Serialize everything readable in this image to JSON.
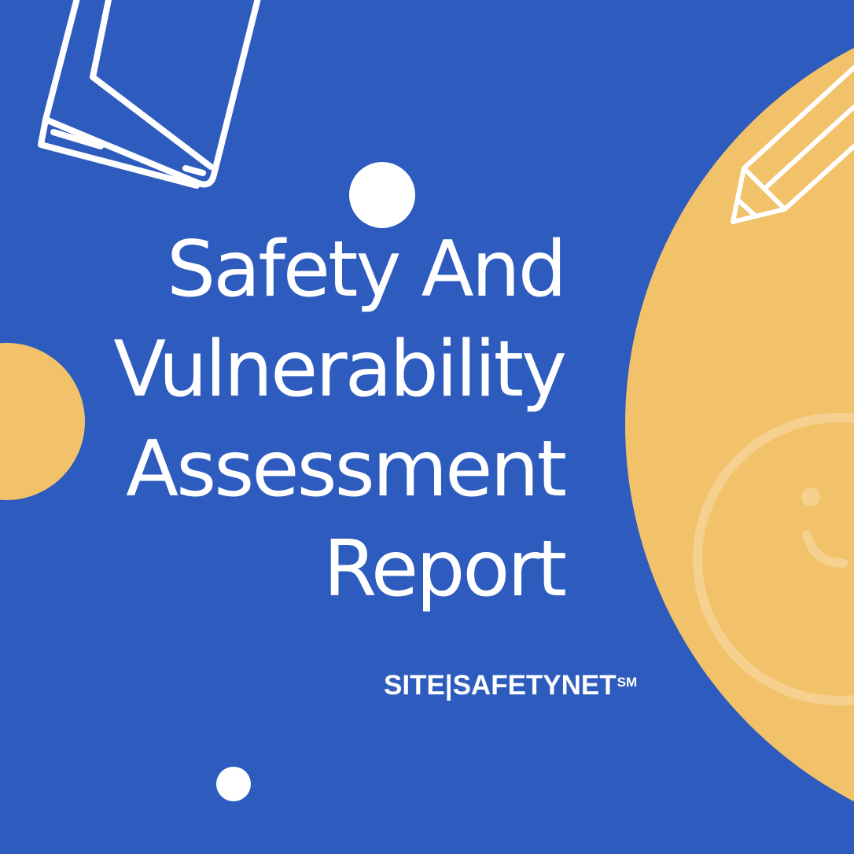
{
  "colors": {
    "background": "#2e5bbe",
    "accent": "#f2c26a",
    "foreground": "#ffffff"
  },
  "title_lines": [
    "Safety And",
    "Vulnerability",
    "Assessment",
    "Report"
  ],
  "brand": {
    "text": "SITE|SAFETYNET",
    "mark": "SM"
  },
  "icons": [
    "book-icon",
    "pencil-icon",
    "smiley-icon"
  ]
}
